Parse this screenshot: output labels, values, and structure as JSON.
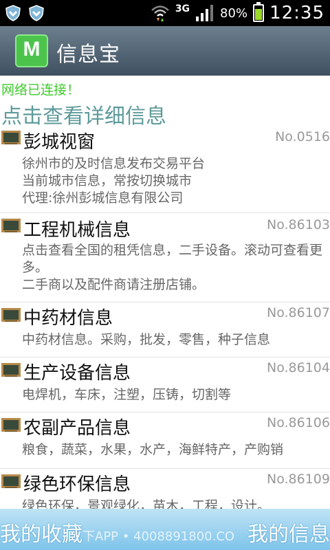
{
  "statusbar": {
    "network": "3G",
    "battery": "80%",
    "battery_level": 0.8,
    "time": "12:35"
  },
  "app": {
    "icon_letter": "M",
    "title": "信息宝"
  },
  "connection_status": "网络已连接！",
  "subtitle": "点击查看详细信息",
  "items": [
    {
      "title": "彭城视窗",
      "no": "No.0516",
      "desc": [
        "徐州市的及时信息发布交易平台",
        "当前城市信息，常按切换城市",
        "代理:徐州彭城信息有限公司"
      ]
    },
    {
      "title": "工程机械信息",
      "no": "No.86103",
      "desc": [
        "点击查看全国的租凭信息，二手设备。滚动可查看更多。",
        "二手商以及配件商请注册店铺。"
      ]
    },
    {
      "title": "中药材信息",
      "no": "No.86107",
      "desc": [
        "中药材信息。采购，批发，零售，种子信息"
      ]
    },
    {
      "title": "生产设备信息",
      "no": "No.86104",
      "desc": [
        "电焊机，车床，注塑，压铸，切割等"
      ]
    },
    {
      "title": "农副产品信息",
      "no": "No.86106",
      "desc": [
        "粮食，蔬菜，水果，水产，海鲜特产，产购销"
      ]
    },
    {
      "title": "绿色环保信息",
      "no": "No.86109",
      "desc": [
        "绿色环保，景观绿化，苗木，工程，设计。"
      ]
    }
  ],
  "bottombar": {
    "left": "我的收藏",
    "right": "我的信息",
    "watermark": "下APP • 4008891800.CO"
  },
  "colors": {
    "connected": "#3ecb2c",
    "subtitle": "#5e9a9a",
    "bottombar": "#7ec4ea"
  }
}
